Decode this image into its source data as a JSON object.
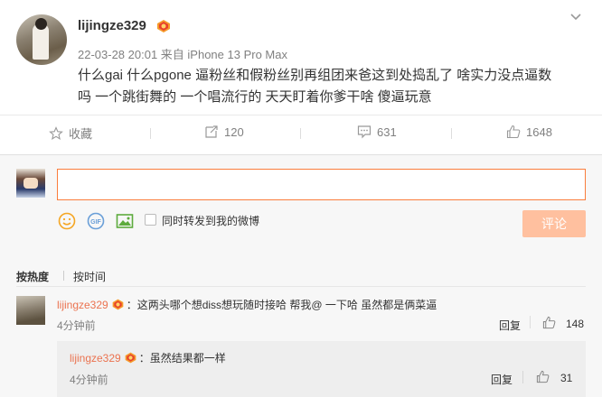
{
  "post": {
    "username": "lijingze329",
    "meta": "22-03-28 20:01  来自 iPhone 13 Pro Max",
    "text_line1": "什么gai 什么pgone 逼粉丝和假粉丝别再组团来爸这到处捣乱了 啥实力没点逼数",
    "text_line2": "吗 一个跳街舞的 一个唱流行的 天天盯着你爹干啥 傻逼玩意"
  },
  "actions": {
    "favorite_label": "收藏",
    "forward_count": "120",
    "comment_count": "631",
    "like_count": "1648"
  },
  "composer": {
    "input_value": "",
    "forward_checkbox_label": "同时转发到我的微博",
    "submit_label": "评论"
  },
  "sort": {
    "tab_hot": "按热度",
    "tab_time": "按时间"
  },
  "comments": [
    {
      "username": "lijingze329",
      "text": "：这两头哪个想diss想玩随时接哈 帮我@ 一下哈 虽然都是俩菜逼",
      "time": "4分钟前",
      "reply_label": "回复",
      "like_count": "148"
    }
  ],
  "replies": [
    {
      "username": "lijingze329",
      "text": "：虽然结果都一样",
      "time": "4分钟前",
      "reply_label": "回复",
      "like_count": "31"
    }
  ],
  "colors": {
    "accent": "#fa7d3c",
    "username_link": "#eb7350",
    "button_disabled": "#ffc09f"
  }
}
